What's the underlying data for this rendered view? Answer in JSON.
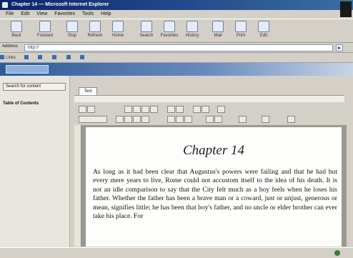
{
  "window": {
    "title": "Chapter 14 — Microsoft Internet Explorer"
  },
  "menu": [
    "File",
    "Edit",
    "View",
    "Favorites",
    "Tools",
    "Help"
  ],
  "toolbar": [
    "Back",
    "Forward",
    "Stop",
    "Refresh",
    "Home",
    "Search",
    "Favorites",
    "History",
    "Mail",
    "Print",
    "Edit"
  ],
  "address": {
    "label": "Address",
    "url": "http://",
    "go": "▸"
  },
  "links": [
    "Links",
    "",
    "",
    "",
    "",
    ""
  ],
  "site": {
    "logo": ""
  },
  "sidebar": {
    "search_button": "Search for content",
    "heading": "Table of Contents",
    "item": ""
  },
  "content": {
    "breadcrumb": "",
    "tab_active": "Text",
    "doc_bar": ""
  },
  "document": {
    "chapter_title": "Chapter 14",
    "body": "As long as it had been clear that Augustus's powers were failing and that he had but every mere years to live, Rome could not accustom itself to the idea of his death. It is not an idle comparison to say that the City felt much as a boy feels when he loses his father. Whether the father has been a brave man or a coward, just or unjust, generous or mean, signifies little; he has been that boy's father, and no uncle or elder brother can ever take his place. For"
  },
  "status": {
    "left": "",
    "right": ""
  }
}
